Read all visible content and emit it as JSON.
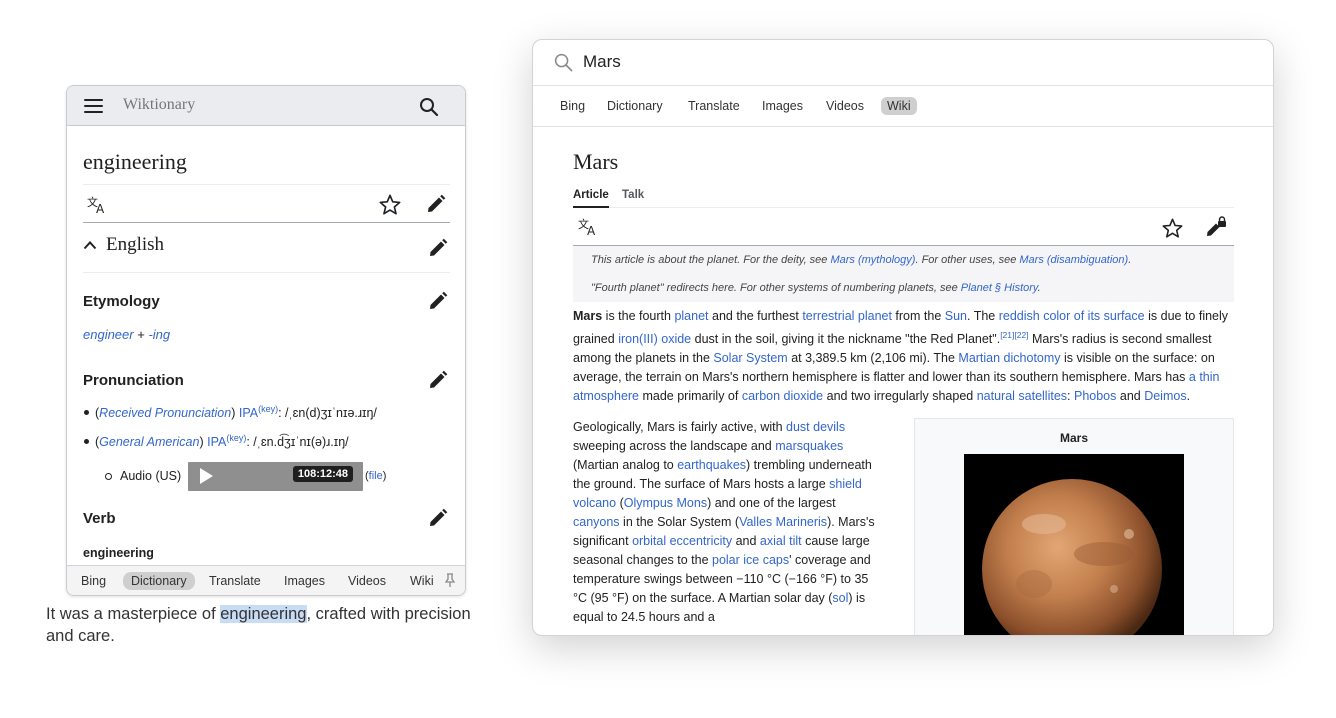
{
  "wiktionary": {
    "site_title": "Wiktionary",
    "word": "engineering",
    "language": "English",
    "etymology": {
      "heading": "Etymology",
      "part1": "engineer",
      "plus": " + ",
      "part2": "-ing"
    },
    "pronunciation": {
      "heading": "Pronunciation",
      "items": [
        {
          "open": "(",
          "accent": "Received Pronunciation",
          "close": ") ",
          "ipa": "IPA",
          "key": "(key)",
          "text": ": /ˌɛn(d)ʒɪˈnɪə.ɹɪŋ/"
        },
        {
          "open": "(",
          "accent": "General American",
          "close": ") ",
          "ipa": "IPA",
          "key": "(key)",
          "text": ": /ˌɛn.d͡ʒɪˈnɪ(ə)ɹ.ɪŋ/"
        }
      ],
      "audio_label": "Audio (US)",
      "audio_time": "108:12:48",
      "file_open": "(",
      "file_link": "file",
      "file_close": ")"
    },
    "verb_heading": "Verb",
    "verb_headword": "engineering",
    "tabs": [
      "Bing",
      "Dictionary",
      "Translate",
      "Images",
      "Videos",
      "Wiki"
    ],
    "active_tab": "Dictionary"
  },
  "sentence": {
    "before": "It was a masterpiece of ",
    "highlight": "engineering",
    "after": ", crafted with precision and care."
  },
  "browser": {
    "query": "Mars",
    "tabs": [
      "Bing",
      "Dictionary",
      "Translate",
      "Images",
      "Videos",
      "Wiki"
    ],
    "active_tab": "Wiki",
    "article": {
      "title": "Mars",
      "tab_article": "Article",
      "tab_talk": "Talk",
      "hatnote1": {
        "t1": "This article is about the planet. For the deity, see ",
        "l1": "Mars (mythology)",
        "t2": ". For other uses, see ",
        "l2": "Mars (disambiguation)",
        "t3": "."
      },
      "hatnote2": {
        "t1": "\"Fourth planet\" redirects here. For other systems of numbering planets, see ",
        "l1": "Planet § History",
        "t2": "."
      },
      "p1": {
        "b": "Mars",
        "s1": " is the fourth ",
        "l1": "planet",
        "s2": " and the furthest ",
        "l2": "terrestrial planet",
        "s3": " from the ",
        "l3": "Sun",
        "s4": ". The ",
        "l4": "reddish color of its surface",
        "s5": " is due to finely grained ",
        "l5": "iron(III) oxide",
        "s6": " dust in the soil, giving it the nickname \"the Red Planet\".",
        "ref": "[21][22]",
        "s7": " Mars's radius is second smallest among the planets in the ",
        "l6": "Solar System",
        "s8": " at 3,389.5 km (2,106 mi). The ",
        "l7": "Martian dichotomy",
        "s9": " is visible on the surface: on average, the terrain on Mars's northern hemisphere is flatter and lower than its southern hemisphere. Mars has ",
        "l8": "a thin atmosphere",
        "s10": " made primarily of ",
        "l9": "carbon dioxide",
        "s11": " and two irregularly shaped ",
        "l10": "natural satellites",
        "s12": ": ",
        "l11": "Phobos",
        "s13": " and ",
        "l12": "Deimos",
        "s14": "."
      },
      "p2": {
        "s1": "Geologically, Mars is fairly active, with ",
        "l1": "dust devils",
        "s2": " sweeping across the landscape and ",
        "l2": "marsquakes",
        "s3": " (Martian analog to ",
        "l3": "earthquakes",
        "s4": ") trembling underneath the ground. The surface of Mars hosts a large ",
        "l4": "shield volcano",
        "s5": " (",
        "l5": "Olympus Mons",
        "s6": ") and one of the largest ",
        "l6": "canyons",
        "s7": " in the Solar System (",
        "l7": "Valles Marineris",
        "s8": "). Mars's significant ",
        "l8": "orbital eccentricity",
        "s9": " and ",
        "l9": "axial tilt",
        "s10": " cause large seasonal changes to the ",
        "l10": "polar ice caps",
        "s11": "' coverage and temperature swings between −110 °C (−166 °F) to 35 °C (95 °F) on the surface. A Martian solar day (",
        "l11": "sol",
        "s12": ") is equal to 24.5 hours and a"
      },
      "infobox_title": "Mars"
    }
  },
  "colors": {
    "link": "#3366cc",
    "highlight": "#c9dcf5",
    "active_tab_bg": "#cfcfcf"
  }
}
